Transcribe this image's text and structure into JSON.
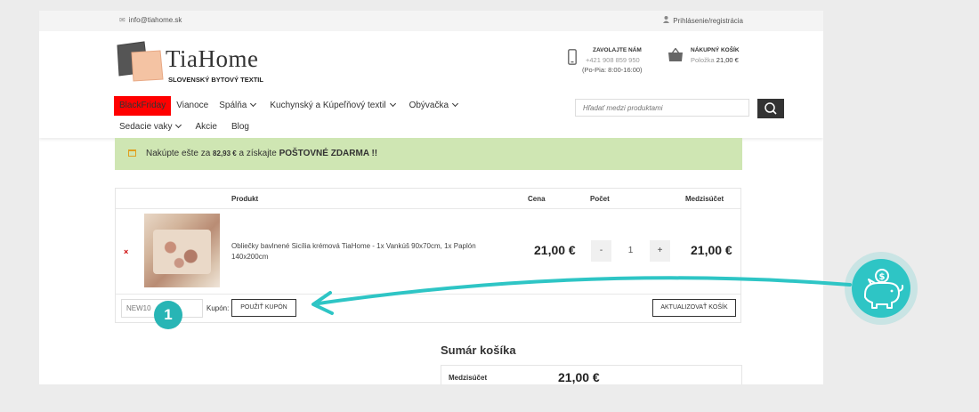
{
  "topbar": {
    "email": "info@tiahome.sk",
    "login": "Prihlásenie/registrácia"
  },
  "logo": {
    "name": "TiaHome",
    "tagline": "SLOVENSKÝ BYTOVÝ TEXTIL"
  },
  "contact": {
    "title": "ZAVOLAJTE NÁM",
    "phone": "+421 908 859 950",
    "hours": "(Po-Pia: 8:00-16:00)"
  },
  "cart": {
    "title": "NÁKUPNÝ KOŠÍK",
    "items_label": "Položka",
    "total": "21,00 €"
  },
  "nav": {
    "row1": [
      {
        "label": "BlackFriday",
        "dropdown": false,
        "highlight": true
      },
      {
        "label": "Vianoce",
        "dropdown": false
      },
      {
        "label": "Spálňa",
        "dropdown": true
      },
      {
        "label": "Kuchynský a Kúpeľňový textil",
        "dropdown": true
      },
      {
        "label": "Obývačka",
        "dropdown": true
      }
    ],
    "row2": [
      {
        "label": "Sedacie vaky",
        "dropdown": true
      },
      {
        "label": "Akcie",
        "dropdown": false
      },
      {
        "label": "Blog",
        "dropdown": false
      }
    ]
  },
  "search": {
    "placeholder": "Hľadať medzi produktami"
  },
  "promo": {
    "prefix": "Nakúpte ešte za ",
    "amount": "82,93 €",
    "middle": " a získajte ",
    "highlight": "POŠTOVNÉ ZDARMA !!"
  },
  "table": {
    "headers": {
      "product": "Produkt",
      "price": "Cena",
      "quantity": "Počet",
      "subtotal": "Medzisúčet"
    },
    "rows": [
      {
        "remove": "×",
        "name": "Obliečky bavlnené Sicília krémová TiaHome - 1x Vankúš 90x70cm, 1x Paplón 140x200cm",
        "price": "21,00 €",
        "quantity": "1",
        "subtotal": "21,00 €"
      }
    ],
    "qty_minus": "-",
    "qty_plus": "+"
  },
  "coupon": {
    "value": "NEW10",
    "label": "Kupón:",
    "apply_button": "POUŽIŤ KUPÓN",
    "update_button": "AKTUALIZOVAŤ KOŠÍK"
  },
  "summary": {
    "title": "Sumár košíka",
    "subtotal_label": "Medzisúčet",
    "subtotal_value": "21,00 €"
  },
  "overlay": {
    "step_badge": "1",
    "piggy_icon": "piggy-bank-icon",
    "accent_color": "#2ec5c5"
  },
  "colors": {
    "promo_bg": "#cfe6b3",
    "blackfriday_bg": "#ff0000",
    "badge": "#28b5b5"
  }
}
